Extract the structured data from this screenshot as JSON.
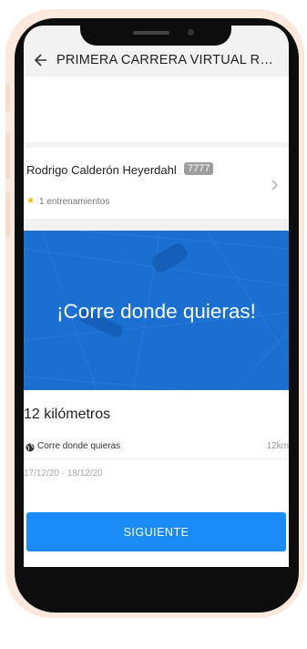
{
  "header": {
    "title": "PRIMERA CARRERA VIRTUAL RE..."
  },
  "runner": {
    "name": "Rodrigo Calderón Heyerdahl",
    "badge": "7777",
    "trainings": "1 entrenamientos"
  },
  "hero": {
    "text": "¡Corre donde quieras!",
    "color": "#1a6fd1"
  },
  "race": {
    "distance": "12 kilómetros",
    "mode_label": "Corre donde quieras",
    "mode_value": "12km",
    "dates": "17/12/20 - 18/12/20"
  },
  "footer": {
    "next_label": "SIGUIENTE",
    "button_color": "#1b8cf7"
  },
  "icons": [
    "back-arrow-icon",
    "star-icon",
    "chevron-right-icon",
    "globe-icon"
  ]
}
